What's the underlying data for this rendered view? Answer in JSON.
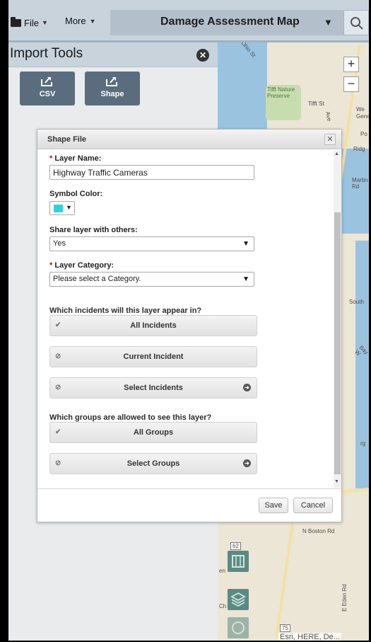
{
  "topbar": {
    "file_label": "File",
    "more_label": "More",
    "map_title": "Damage Assessment Map",
    "dropdown_icon": "caret-down-icon",
    "search_icon": "search-icon"
  },
  "import_tools": {
    "title": "Import Tools",
    "close_icon": "close-circle-icon",
    "csv_label": "CSV",
    "shape_label": "Shape"
  },
  "dialog": {
    "title": "Shape File",
    "layer_name_label": "Layer Name:",
    "layer_name_value": "Highway Traffic Cameras",
    "symbol_color_label": "Symbol Color:",
    "symbol_color": "#2fd3e0",
    "share_label": "Share layer with others:",
    "share_value": "Yes",
    "category_label": "Layer Category:",
    "category_value": "Please select a Category.",
    "incidents_question": "Which incidents will this layer appear in?",
    "incident_options": [
      "All Incidents",
      "Current Incident",
      "Select Incidents"
    ],
    "groups_question": "Which groups are allowed to see this layer?",
    "group_options": [
      "All Groups",
      "Select Groups"
    ],
    "save_label": "Save",
    "cancel_label": "Cancel",
    "required_mark": "*"
  },
  "map": {
    "labels": [
      "Tifft Nature Preserve",
      "Tifft St",
      "Ohio St",
      "N Boston Rd",
      "E Eden Rd",
      "Ridg",
      "Martin Rd",
      "South",
      "Bay W",
      "We",
      "Gene",
      "Po",
      "Ave",
      "rg",
      "en",
      "Ch"
    ],
    "zoom_in": "+",
    "zoom_out": "−",
    "attribution": "Esri, HERE, De...",
    "route_badge": "62",
    "route_badge_2": "75"
  }
}
